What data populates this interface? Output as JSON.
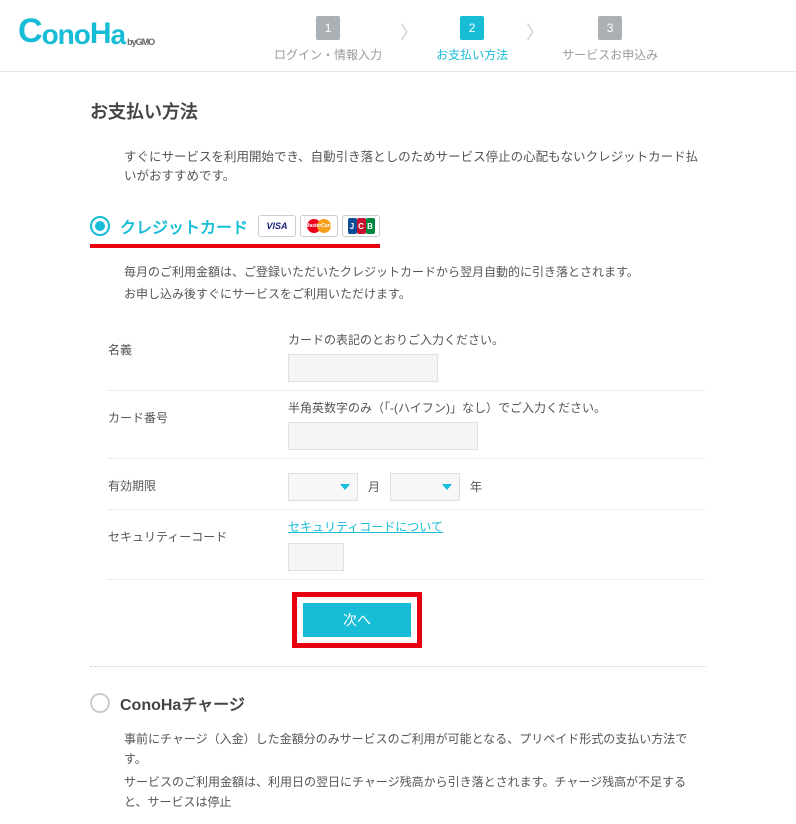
{
  "logo": {
    "text": "ConoHa",
    "sub": "byGMO"
  },
  "steps": [
    {
      "num": "1",
      "label": "ログイン・情報入力",
      "active": false
    },
    {
      "num": "2",
      "label": "お支払い方法",
      "active": true
    },
    {
      "num": "3",
      "label": "サービスお申込み",
      "active": false
    }
  ],
  "page_title": "お支払い方法",
  "intro": "すぐにサービスを利用開始でき、自動引き落としのためサービス停止の心配もないクレジットカード払いがおすすめです。",
  "credit_card": {
    "label": "クレジットカード",
    "brands": [
      "VISA",
      "MasterCard",
      "JCB"
    ],
    "desc_line1": "毎月のご利用金額は、ご登録いただいたクレジットカードから翌月自動的に引き落とされます。",
    "desc_line2": "お申し込み後すぐにサービスをご利用いただけます。",
    "fields": {
      "name": {
        "label": "名義",
        "hint": "カードの表記のとおりご入力ください。"
      },
      "number": {
        "label": "カード番号",
        "hint": "半角英数字のみ（「-(ハイフン)」なし）でご入力ください。"
      },
      "expiry": {
        "label": "有効期限",
        "month_unit": "月",
        "year_unit": "年"
      },
      "cvv": {
        "label": "セキュリティーコード",
        "link": "セキュリティコードについて"
      }
    },
    "next_button": "次へ"
  },
  "conoha_charge": {
    "label": "ConoHaチャージ",
    "desc_line1": "事前にチャージ（入金）した金額分のみサービスのご利用が可能となる、プリペイド形式の支払い方法です。",
    "desc_line2": "サービスのご利用金額は、利用日の翌日にチャージ残高から引き落とされます。チャージ残高が不足すると、サービスは停止"
  }
}
